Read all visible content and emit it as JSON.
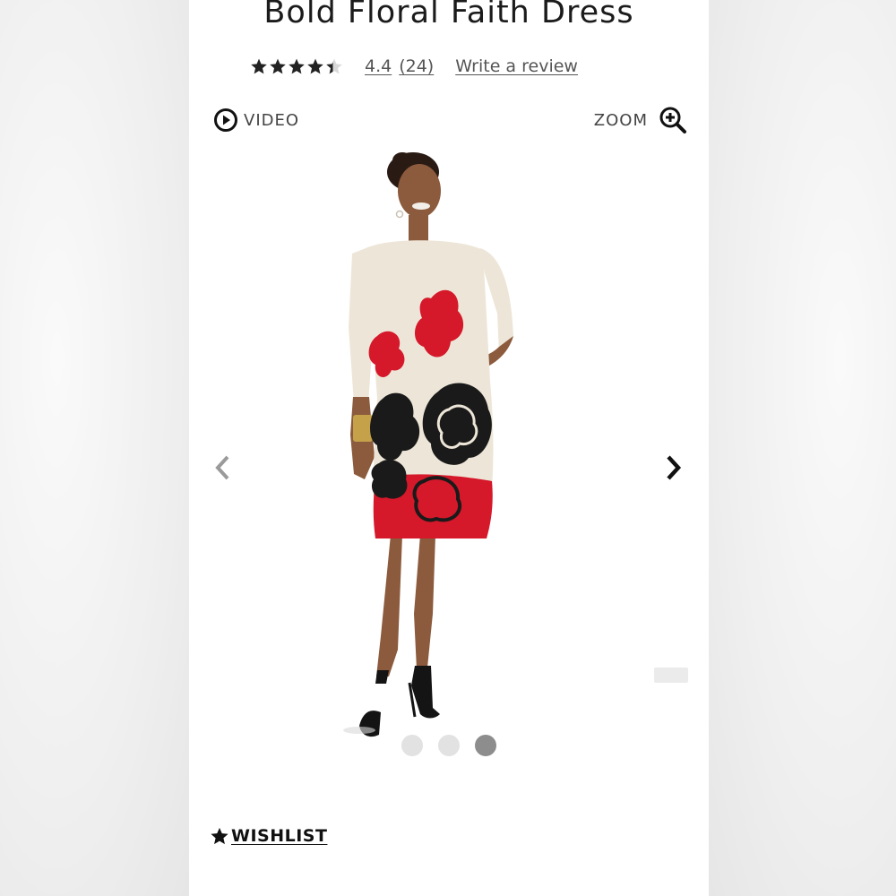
{
  "product": {
    "title": "Bold Floral Faith Dress",
    "rating_value": "4.4",
    "rating_stars": 4.4,
    "rating_count": "(24)",
    "write_review_label": "Write a review"
  },
  "media_toolbar": {
    "video_label": "VIDEO",
    "zoom_label": "ZOOM"
  },
  "gallery": {
    "image_subject": "dress-model-photo",
    "slide_count": 3,
    "active_slide": 3
  },
  "actions": {
    "wishlist_label": "WISHLIST"
  },
  "colors": {
    "dress_cream": "#ede6d8",
    "dress_red": "#d5182a",
    "dress_black": "#1a1a1a",
    "dot_active": "#8d8d8d",
    "dot_inactive": "#e2e2e2"
  },
  "icons": {
    "play": "play-circle-icon",
    "zoom": "zoom-in-icon",
    "prev": "chevron-left-icon",
    "next": "chevron-right-icon",
    "wishlist": "star-icon"
  }
}
